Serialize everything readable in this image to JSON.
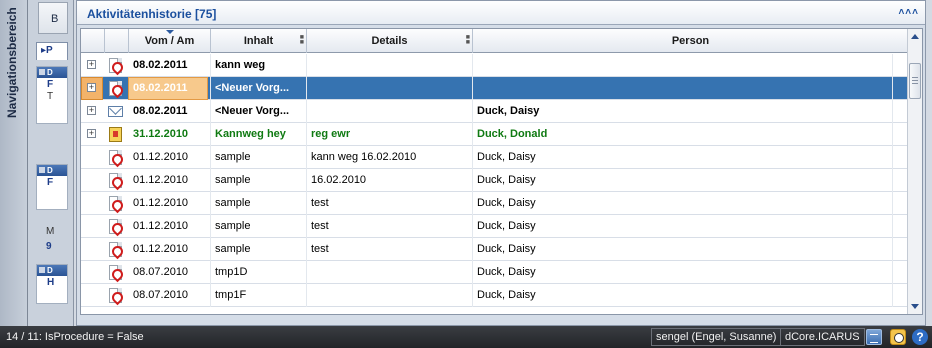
{
  "nav": {
    "vertical_label": "Navigationsbereich",
    "panel_button": "B",
    "tab_label": "P",
    "box1_header": "D",
    "box1_lines": [
      "F",
      "T"
    ],
    "box2_header": "D",
    "box2_lines": [
      "F"
    ],
    "box3_lines": [
      "M",
      "9"
    ],
    "box4_header": "D",
    "box4_lines": [
      "H"
    ]
  },
  "pane": {
    "title": "Aktivitätenhistorie [75]",
    "collapse_glyph": "˄˄˄"
  },
  "grid": {
    "columns": [
      {
        "key": "expand",
        "label": ""
      },
      {
        "key": "icon",
        "label": ""
      },
      {
        "key": "date",
        "label": "Vom / Am"
      },
      {
        "key": "content",
        "label": "Inhalt"
      },
      {
        "key": "details",
        "label": "Details"
      },
      {
        "key": "person",
        "label": "Person"
      }
    ],
    "rows": [
      {
        "expandable": true,
        "icon": "pdf-icon",
        "date": "08.02.2011",
        "content": "kann weg",
        "details": "",
        "person": "",
        "bold": true,
        "green": false,
        "selected": false
      },
      {
        "expandable": true,
        "icon": "pdf-icon",
        "date": "08.02.2011",
        "content": "<Neuer Vorg...",
        "details": "",
        "person": "",
        "bold": true,
        "green": false,
        "selected": true
      },
      {
        "expandable": true,
        "icon": "mail-icon",
        "date": "08.02.2011",
        "content": "<Neuer Vorg...",
        "details": "",
        "person": "Duck, Daisy",
        "bold": true,
        "green": false,
        "selected": false
      },
      {
        "expandable": true,
        "icon": "task-icon",
        "date": "31.12.2010",
        "content": "Kannweg hey",
        "details": "reg ewr",
        "person": "Duck, Donald",
        "bold": true,
        "green": true,
        "selected": false
      },
      {
        "expandable": false,
        "icon": "pdf-icon",
        "date": "01.12.2010",
        "content": "sample",
        "details": "kann weg 16.02.2010",
        "person": "Duck, Daisy",
        "bold": false,
        "green": false,
        "selected": false
      },
      {
        "expandable": false,
        "icon": "pdf-icon",
        "date": "01.12.2010",
        "content": "sample",
        "details": "16.02.2010",
        "person": "Duck, Daisy",
        "bold": false,
        "green": false,
        "selected": false
      },
      {
        "expandable": false,
        "icon": "pdf-icon",
        "date": "01.12.2010",
        "content": "sample",
        "details": "test",
        "person": "Duck, Daisy",
        "bold": false,
        "green": false,
        "selected": false
      },
      {
        "expandable": false,
        "icon": "pdf-icon",
        "date": "01.12.2010",
        "content": "sample",
        "details": "test",
        "person": "Duck, Daisy",
        "bold": false,
        "green": false,
        "selected": false
      },
      {
        "expandable": false,
        "icon": "pdf-icon",
        "date": "01.12.2010",
        "content": "sample",
        "details": "test",
        "person": "Duck, Daisy",
        "bold": false,
        "green": false,
        "selected": false
      },
      {
        "expandable": false,
        "icon": "pdf-icon",
        "date": "08.07.2010",
        "content": "tmp1D",
        "details": "",
        "person": "Duck, Daisy",
        "bold": false,
        "green": false,
        "selected": false
      },
      {
        "expandable": false,
        "icon": "pdf-icon",
        "date": "08.07.2010",
        "content": "tmp1F",
        "details": "",
        "person": "Duck, Daisy",
        "bold": false,
        "green": false,
        "selected": false
      }
    ]
  },
  "status": {
    "left_text": "14 / 11: IsProcedure = False",
    "user": "sengel (Engel, Susanne)",
    "system": "dCore.ICARUS",
    "icons": [
      "database-icon",
      "clock-icon",
      "help-icon"
    ]
  },
  "colors": {
    "selection": "#3673b1",
    "green_text": "#0f7a12",
    "title_blue": "#1b4f9e",
    "statusbar": "#2b2d31"
  }
}
